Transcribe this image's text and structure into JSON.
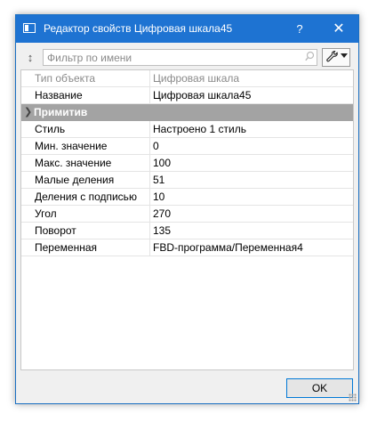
{
  "window": {
    "title": "Редактор свойств Цифровая шкала45",
    "help_label": "?",
    "close_label": "✕"
  },
  "filter": {
    "placeholder": "Фильтр по имени",
    "value": ""
  },
  "icons": {
    "app": "window-icon",
    "expand": "expand-vertical-icon",
    "search": "search-icon",
    "tools": "wrench-icon",
    "dropdown": "chevron-down-icon",
    "group_toggle": "chevron-right-icon",
    "resize": "resize-grip-icon"
  },
  "grid": {
    "header": {
      "key": "Тип объекта",
      "value": "Цифровая шкала"
    },
    "name_row": {
      "key": "Название",
      "value": "Цифровая шкала45"
    },
    "group": {
      "label": "Примитив"
    },
    "rows": [
      {
        "key": "Стиль",
        "value": "Настроено 1 стиль"
      },
      {
        "key": "Мин. значение",
        "value": "0"
      },
      {
        "key": "Макс. значение",
        "value": "100"
      },
      {
        "key": "Малые деления",
        "value": "51"
      },
      {
        "key": "Деления с подписью",
        "value": "10"
      },
      {
        "key": "Угол",
        "value": "270"
      },
      {
        "key": "Поворот",
        "value": "135"
      },
      {
        "key": "Переменная",
        "value": "FBD-программа/Переменная4"
      }
    ]
  },
  "footer": {
    "ok_label": "OK"
  },
  "colors": {
    "titlebar": "#1e73d2",
    "group_row": "#a3a3a3",
    "ok_border": "#0078d7"
  }
}
